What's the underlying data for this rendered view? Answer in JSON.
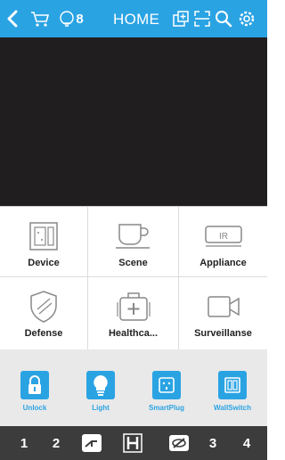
{
  "header": {
    "title": "HOME",
    "notification_count": "8",
    "icons": [
      "back-icon",
      "cart-icon",
      "bell-icon",
      "add-device-icon",
      "scan-icon",
      "search-icon",
      "settings-icon"
    ]
  },
  "grid": {
    "items": [
      {
        "label": "Device",
        "icon": "device-panel-icon"
      },
      {
        "label": "Scene",
        "icon": "scene-cup-icon"
      },
      {
        "label": "Appliance",
        "icon": "ir-appliance-icon"
      },
      {
        "label": "Defense",
        "icon": "shield-icon"
      },
      {
        "label": "Healthca...",
        "icon": "medical-kit-icon"
      },
      {
        "label": "Surveillanse",
        "icon": "camera-icon"
      }
    ]
  },
  "quick": {
    "items": [
      {
        "label": "Unlock",
        "icon": "lock-icon"
      },
      {
        "label": "Light",
        "icon": "bulb-icon"
      },
      {
        "label": "SmartPlug",
        "icon": "plug-icon"
      },
      {
        "label": "WallSwitch",
        "icon": "wall-switch-icon"
      }
    ]
  },
  "bottom": {
    "items": [
      "1",
      "2",
      "3",
      "4"
    ],
    "icons": [
      "camera-move-icon",
      "h-icon",
      "eye-off-icon"
    ]
  },
  "colors": {
    "accent": "#2aa3e3",
    "video_bg": "#201e1f",
    "bottom_bg": "#3c3c3c",
    "quick_bg": "#e9e9e9"
  }
}
